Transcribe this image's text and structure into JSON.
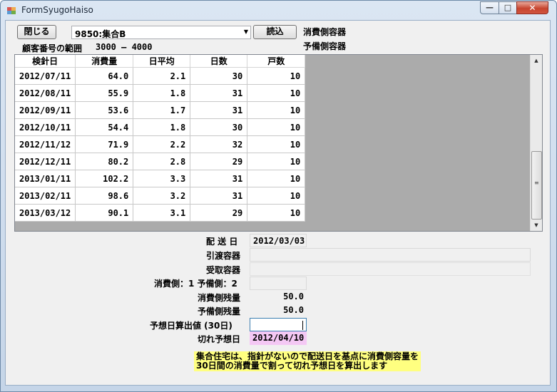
{
  "window": {
    "title": "FormSyugoHaiso",
    "minimize": "—",
    "maximize": "□",
    "close": "✕"
  },
  "toolbar": {
    "close_label": "閉じる",
    "combo_value": "9850:集合B",
    "read_label": "読込",
    "consumer_container_label": "消費側容器",
    "spare_container_label": "予備側容器",
    "customer_range_label": "顧客番号の範囲",
    "customer_range_value": "3000 ― 4000"
  },
  "table": {
    "columns": [
      "検針日",
      "消費量",
      "日平均",
      "日数",
      "戸数"
    ],
    "rows": [
      [
        "2012/07/11",
        "64.0",
        "2.1",
        "30",
        "10"
      ],
      [
        "2012/08/11",
        "55.9",
        "1.8",
        "31",
        "10"
      ],
      [
        "2012/09/11",
        "53.6",
        "1.7",
        "31",
        "10"
      ],
      [
        "2012/10/11",
        "54.4",
        "1.8",
        "30",
        "10"
      ],
      [
        "2012/11/12",
        "71.9",
        "2.2",
        "32",
        "10"
      ],
      [
        "2012/12/11",
        "80.2",
        "2.8",
        "29",
        "10"
      ],
      [
        "2013/01/11",
        "102.2",
        "3.3",
        "31",
        "10"
      ],
      [
        "2013/02/11",
        "98.6",
        "3.2",
        "31",
        "10"
      ],
      [
        "2013/03/12",
        "90.1",
        "3.1",
        "29",
        "10"
      ]
    ]
  },
  "form": {
    "delivery_date_label": "配 送 日",
    "delivery_date_value": "2012/03/03",
    "handover_label": "引渡容器",
    "handover_value": "",
    "receive_label": "受取容器",
    "receive_value": "",
    "side_label": "消費側：1 予備側：2",
    "side_value": "",
    "consumer_remain_label": "消費側残量",
    "consumer_remain_value": "50.0",
    "spare_remain_label": "予備側残量",
    "spare_remain_value": "50.0",
    "forecast_calc_label": "予想日算出値 (30日)",
    "forecast_calc_value": "",
    "cutoff_label": "切れ予想日",
    "cutoff_value": "2012/04/10"
  },
  "note": {
    "line1": "集合住宅は、指針がないので配送日を基点に消費側容量を",
    "line2": "30日間の消費量で割って切れ予想日を算出します"
  },
  "colors": {
    "cutoff_highlight": "#f4c8f4",
    "note_highlight": "#ffff80",
    "grid_empty": "#ababab"
  }
}
